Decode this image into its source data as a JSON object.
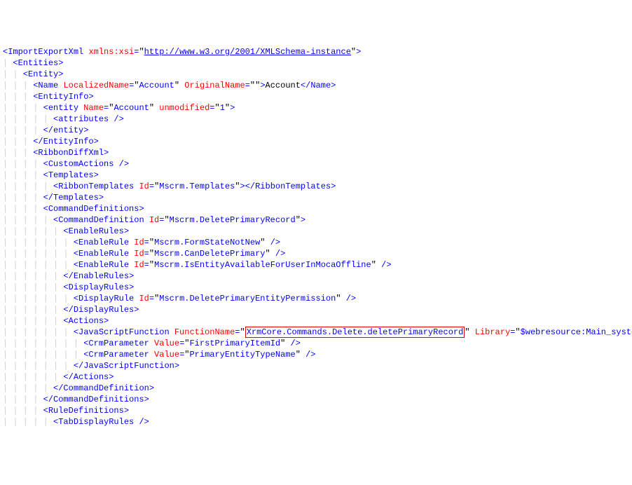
{
  "lines": [
    {
      "indent": 0,
      "segments": [
        {
          "t": "<",
          "c": "b"
        },
        {
          "t": "ImportExportXml",
          "c": "b"
        },
        {
          "t": " ",
          "c": "k"
        },
        {
          "t": "xmlns:xsi",
          "c": "r"
        },
        {
          "t": "=",
          "c": "b"
        },
        {
          "t": "\"",
          "c": "k"
        },
        {
          "t": "http://www.w3.org/2001/XMLSchema-instance",
          "c": "url"
        },
        {
          "t": "\"",
          "c": "k"
        },
        {
          "t": ">",
          "c": "b"
        }
      ]
    },
    {
      "indent": 1,
      "segments": [
        {
          "t": "<",
          "c": "b"
        },
        {
          "t": "Entities",
          "c": "b"
        },
        {
          "t": ">",
          "c": "b"
        }
      ]
    },
    {
      "indent": 2,
      "segments": [
        {
          "t": "<",
          "c": "b"
        },
        {
          "t": "Entity",
          "c": "b"
        },
        {
          "t": ">",
          "c": "b"
        }
      ]
    },
    {
      "indent": 3,
      "segments": [
        {
          "t": "<",
          "c": "b"
        },
        {
          "t": "Name",
          "c": "b"
        },
        {
          "t": " ",
          "c": "k"
        },
        {
          "t": "LocalizedName",
          "c": "r"
        },
        {
          "t": "=",
          "c": "b"
        },
        {
          "t": "\"",
          "c": "k"
        },
        {
          "t": "Account",
          "c": "b"
        },
        {
          "t": "\"",
          "c": "k"
        },
        {
          "t": " ",
          "c": "k"
        },
        {
          "t": "OriginalName",
          "c": "r"
        },
        {
          "t": "=",
          "c": "b"
        },
        {
          "t": "\"\"",
          "c": "k"
        },
        {
          "t": ">",
          "c": "b"
        },
        {
          "t": "Account",
          "c": "k"
        },
        {
          "t": "</",
          "c": "b"
        },
        {
          "t": "Name",
          "c": "b"
        },
        {
          "t": ">",
          "c": "b"
        }
      ]
    },
    {
      "indent": 3,
      "segments": [
        {
          "t": "<",
          "c": "b"
        },
        {
          "t": "EntityInfo",
          "c": "b"
        },
        {
          "t": ">",
          "c": "b"
        }
      ]
    },
    {
      "indent": 4,
      "segments": [
        {
          "t": "<",
          "c": "b"
        },
        {
          "t": "entity",
          "c": "b"
        },
        {
          "t": " ",
          "c": "k"
        },
        {
          "t": "Name",
          "c": "r"
        },
        {
          "t": "=",
          "c": "b"
        },
        {
          "t": "\"",
          "c": "k"
        },
        {
          "t": "Account",
          "c": "b"
        },
        {
          "t": "\"",
          "c": "k"
        },
        {
          "t": " ",
          "c": "k"
        },
        {
          "t": "unmodified",
          "c": "r"
        },
        {
          "t": "=",
          "c": "b"
        },
        {
          "t": "\"",
          "c": "k"
        },
        {
          "t": "1",
          "c": "b"
        },
        {
          "t": "\"",
          "c": "k"
        },
        {
          "t": ">",
          "c": "b"
        }
      ]
    },
    {
      "indent": 5,
      "segments": [
        {
          "t": "<",
          "c": "b"
        },
        {
          "t": "attributes",
          "c": "b"
        },
        {
          "t": " />",
          "c": "b"
        }
      ]
    },
    {
      "indent": 4,
      "segments": [
        {
          "t": "</",
          "c": "b"
        },
        {
          "t": "entity",
          "c": "b"
        },
        {
          "t": ">",
          "c": "b"
        }
      ]
    },
    {
      "indent": 3,
      "segments": [
        {
          "t": "</",
          "c": "b"
        },
        {
          "t": "EntityInfo",
          "c": "b"
        },
        {
          "t": ">",
          "c": "b"
        }
      ]
    },
    {
      "indent": 3,
      "segments": [
        {
          "t": "<",
          "c": "b"
        },
        {
          "t": "RibbonDiffXml",
          "c": "b"
        },
        {
          "t": ">",
          "c": "b"
        }
      ]
    },
    {
      "indent": 4,
      "segments": [
        {
          "t": "<",
          "c": "b"
        },
        {
          "t": "CustomActions",
          "c": "b"
        },
        {
          "t": " />",
          "c": "b"
        }
      ]
    },
    {
      "indent": 4,
      "segments": [
        {
          "t": "<",
          "c": "b"
        },
        {
          "t": "Templates",
          "c": "b"
        },
        {
          "t": ">",
          "c": "b"
        }
      ]
    },
    {
      "indent": 5,
      "segments": [
        {
          "t": "<",
          "c": "b"
        },
        {
          "t": "RibbonTemplates",
          "c": "b"
        },
        {
          "t": " ",
          "c": "k"
        },
        {
          "t": "Id",
          "c": "r"
        },
        {
          "t": "=",
          "c": "b"
        },
        {
          "t": "\"",
          "c": "k"
        },
        {
          "t": "Mscrm.Templates",
          "c": "b"
        },
        {
          "t": "\"",
          "c": "k"
        },
        {
          "t": "></",
          "c": "b"
        },
        {
          "t": "RibbonTemplates",
          "c": "b"
        },
        {
          "t": ">",
          "c": "b"
        }
      ]
    },
    {
      "indent": 4,
      "segments": [
        {
          "t": "</",
          "c": "b"
        },
        {
          "t": "Templates",
          "c": "b"
        },
        {
          "t": ">",
          "c": "b"
        }
      ]
    },
    {
      "indent": 4,
      "segments": [
        {
          "t": "<",
          "c": "b"
        },
        {
          "t": "CommandDefinitions",
          "c": "b"
        },
        {
          "t": ">",
          "c": "b"
        }
      ]
    },
    {
      "indent": 5,
      "segments": [
        {
          "t": "<",
          "c": "b"
        },
        {
          "t": "CommandDefinition",
          "c": "b"
        },
        {
          "t": " ",
          "c": "k"
        },
        {
          "t": "Id",
          "c": "r"
        },
        {
          "t": "=",
          "c": "b"
        },
        {
          "t": "\"",
          "c": "k"
        },
        {
          "t": "Mscrm.DeletePrimaryRecord",
          "c": "b"
        },
        {
          "t": "\"",
          "c": "k"
        },
        {
          "t": ">",
          "c": "b"
        }
      ]
    },
    {
      "indent": 6,
      "segments": [
        {
          "t": "<",
          "c": "b"
        },
        {
          "t": "EnableRules",
          "c": "b"
        },
        {
          "t": ">",
          "c": "b"
        }
      ]
    },
    {
      "indent": 7,
      "segments": [
        {
          "t": "<",
          "c": "b"
        },
        {
          "t": "EnableRule",
          "c": "b"
        },
        {
          "t": " ",
          "c": "k"
        },
        {
          "t": "Id",
          "c": "r"
        },
        {
          "t": "=",
          "c": "b"
        },
        {
          "t": "\"",
          "c": "k"
        },
        {
          "t": "Mscrm.FormStateNotNew",
          "c": "b"
        },
        {
          "t": "\"",
          "c": "k"
        },
        {
          "t": " />",
          "c": "b"
        }
      ]
    },
    {
      "indent": 7,
      "segments": [
        {
          "t": "<",
          "c": "b"
        },
        {
          "t": "EnableRule",
          "c": "b"
        },
        {
          "t": " ",
          "c": "k"
        },
        {
          "t": "Id",
          "c": "r"
        },
        {
          "t": "=",
          "c": "b"
        },
        {
          "t": "\"",
          "c": "k"
        },
        {
          "t": "Mscrm.CanDeletePrimary",
          "c": "b"
        },
        {
          "t": "\"",
          "c": "k"
        },
        {
          "t": " />",
          "c": "b"
        }
      ]
    },
    {
      "indent": 7,
      "segments": [
        {
          "t": "<",
          "c": "b"
        },
        {
          "t": "EnableRule",
          "c": "b"
        },
        {
          "t": " ",
          "c": "k"
        },
        {
          "t": "Id",
          "c": "r"
        },
        {
          "t": "=",
          "c": "b"
        },
        {
          "t": "\"",
          "c": "k"
        },
        {
          "t": "Mscrm.IsEntityAvailableForUserInMocaOffline",
          "c": "b"
        },
        {
          "t": "\"",
          "c": "k"
        },
        {
          "t": " />",
          "c": "b"
        }
      ]
    },
    {
      "indent": 6,
      "segments": [
        {
          "t": "</",
          "c": "b"
        },
        {
          "t": "EnableRules",
          "c": "b"
        },
        {
          "t": ">",
          "c": "b"
        }
      ]
    },
    {
      "indent": 6,
      "segments": [
        {
          "t": "<",
          "c": "b"
        },
        {
          "t": "DisplayRules",
          "c": "b"
        },
        {
          "t": ">",
          "c": "b"
        }
      ]
    },
    {
      "indent": 7,
      "segments": [
        {
          "t": "<",
          "c": "b"
        },
        {
          "t": "DisplayRule",
          "c": "b"
        },
        {
          "t": " ",
          "c": "k"
        },
        {
          "t": "Id",
          "c": "r"
        },
        {
          "t": "=",
          "c": "b"
        },
        {
          "t": "\"",
          "c": "k"
        },
        {
          "t": "Mscrm.DeletePrimaryEntityPermission",
          "c": "b"
        },
        {
          "t": "\"",
          "c": "k"
        },
        {
          "t": " />",
          "c": "b"
        }
      ]
    },
    {
      "indent": 6,
      "segments": [
        {
          "t": "</",
          "c": "b"
        },
        {
          "t": "DisplayRules",
          "c": "b"
        },
        {
          "t": ">",
          "c": "b"
        }
      ]
    },
    {
      "indent": 6,
      "segments": [
        {
          "t": "<",
          "c": "b"
        },
        {
          "t": "Actions",
          "c": "b"
        },
        {
          "t": ">",
          "c": "b"
        }
      ]
    },
    {
      "indent": 7,
      "segments": [
        {
          "t": "<",
          "c": "b"
        },
        {
          "t": "JavaScriptFunction",
          "c": "b"
        },
        {
          "t": " ",
          "c": "k"
        },
        {
          "t": "FunctionName",
          "c": "r"
        },
        {
          "t": "=",
          "c": "b"
        },
        {
          "t": "\"",
          "c": "k"
        },
        {
          "t": "XrmCore.Commands.Delete.deletePrimaryRecord",
          "c": "hl"
        },
        {
          "t": "\"",
          "c": "k"
        },
        {
          "t": " ",
          "c": "k"
        },
        {
          "t": "Library",
          "c": "r"
        },
        {
          "t": "=",
          "c": "b"
        },
        {
          "t": "\"",
          "c": "k"
        },
        {
          "t": "$webresource:Main_system_library.js",
          "c": "b"
        },
        {
          "t": "\"",
          "c": "k"
        },
        {
          "t": ">",
          "c": "b"
        }
      ]
    },
    {
      "indent": 8,
      "segments": [
        {
          "t": "<",
          "c": "b"
        },
        {
          "t": "CrmParameter",
          "c": "b"
        },
        {
          "t": " ",
          "c": "k"
        },
        {
          "t": "Value",
          "c": "r"
        },
        {
          "t": "=",
          "c": "b"
        },
        {
          "t": "\"",
          "c": "k"
        },
        {
          "t": "FirstPrimaryItemId",
          "c": "b"
        },
        {
          "t": "\"",
          "c": "k"
        },
        {
          "t": " />",
          "c": "b"
        }
      ]
    },
    {
      "indent": 8,
      "segments": [
        {
          "t": "<",
          "c": "b"
        },
        {
          "t": "CrmParameter",
          "c": "b"
        },
        {
          "t": " ",
          "c": "k"
        },
        {
          "t": "Value",
          "c": "r"
        },
        {
          "t": "=",
          "c": "b"
        },
        {
          "t": "\"",
          "c": "k"
        },
        {
          "t": "PrimaryEntityTypeName",
          "c": "b"
        },
        {
          "t": "\"",
          "c": "k"
        },
        {
          "t": " />",
          "c": "b"
        }
      ]
    },
    {
      "indent": 7,
      "segments": [
        {
          "t": "</",
          "c": "b"
        },
        {
          "t": "JavaScriptFunction",
          "c": "b"
        },
        {
          "t": ">",
          "c": "b"
        }
      ]
    },
    {
      "indent": 6,
      "segments": [
        {
          "t": "</",
          "c": "b"
        },
        {
          "t": "Actions",
          "c": "b"
        },
        {
          "t": ">",
          "c": "b"
        }
      ]
    },
    {
      "indent": 5,
      "segments": [
        {
          "t": "</",
          "c": "b"
        },
        {
          "t": "CommandDefinition",
          "c": "b"
        },
        {
          "t": ">",
          "c": "b"
        }
      ]
    },
    {
      "indent": 4,
      "segments": [
        {
          "t": "</",
          "c": "b"
        },
        {
          "t": "CommandDefinitions",
          "c": "b"
        },
        {
          "t": ">",
          "c": "b"
        }
      ]
    },
    {
      "indent": 4,
      "segments": [
        {
          "t": "<",
          "c": "b"
        },
        {
          "t": "RuleDefinitions",
          "c": "b"
        },
        {
          "t": ">",
          "c": "b"
        }
      ]
    },
    {
      "indent": 5,
      "segments": [
        {
          "t": "<",
          "c": "b"
        },
        {
          "t": "TabDisplayRules",
          "c": "b"
        },
        {
          "t": " />",
          "c": "b"
        }
      ]
    }
  ],
  "maxIndent": 9
}
